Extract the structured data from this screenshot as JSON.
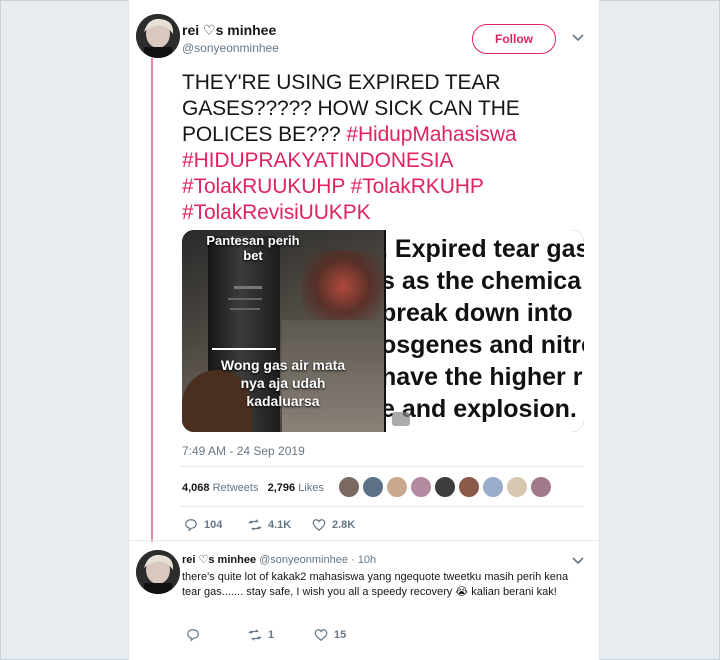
{
  "tweet": {
    "author_name": "rei ♡s minhee",
    "author_handle": "@sonyeonminhee",
    "follow_label": "Follow",
    "text_plain": "THEY'RE USING EXPIRED TEAR GASES????? HOW SICK CAN THE POLICES BE???",
    "hashtags": [
      "#HidupMahasiswa",
      "#HIDUPRAKYATINDONESIA",
      "#TolakRUUKUHP",
      "#TolakRKUHP",
      "#TolakRevisiUUKPK"
    ],
    "media": {
      "left_caption_top": "Pantesan perih bet",
      "left_caption_bottom_1": "Wong gas air mata",
      "left_caption_bottom_2": "nya aja udah",
      "left_caption_bottom_3": "kadaluarsa",
      "right_lines": [
        ". Expired tear gas",
        "s as the chemica",
        "break down into",
        "osgenes and nitro",
        "have the higher r",
        "e and explosion."
      ]
    },
    "timestamp": "7:49 AM - 24 Sep 2019",
    "retweets_count": "4,068",
    "retweets_label": "Retweets",
    "likes_count": "2,796",
    "likes_label": "Likes",
    "reply_count": "104",
    "retweet_count_short": "4.1K",
    "like_count_short": "2.8K"
  },
  "reply": {
    "author_name": "rei ♡s minhee",
    "author_handle": "@sonyeonminhee",
    "time": "· 10h",
    "text": "there's quite lot of kakak2 mahasiswa yang ngequote tweetku masih perih kena tear gas....... stay safe, I wish you all a speedy recovery 😭 kalian berani kak!",
    "reply_count": "",
    "retweet_count": "1",
    "like_count": "15"
  },
  "colors": {
    "accent": "#e0245e",
    "text": "#14171a",
    "muted": "#657786",
    "background": "#e6ecf0"
  }
}
